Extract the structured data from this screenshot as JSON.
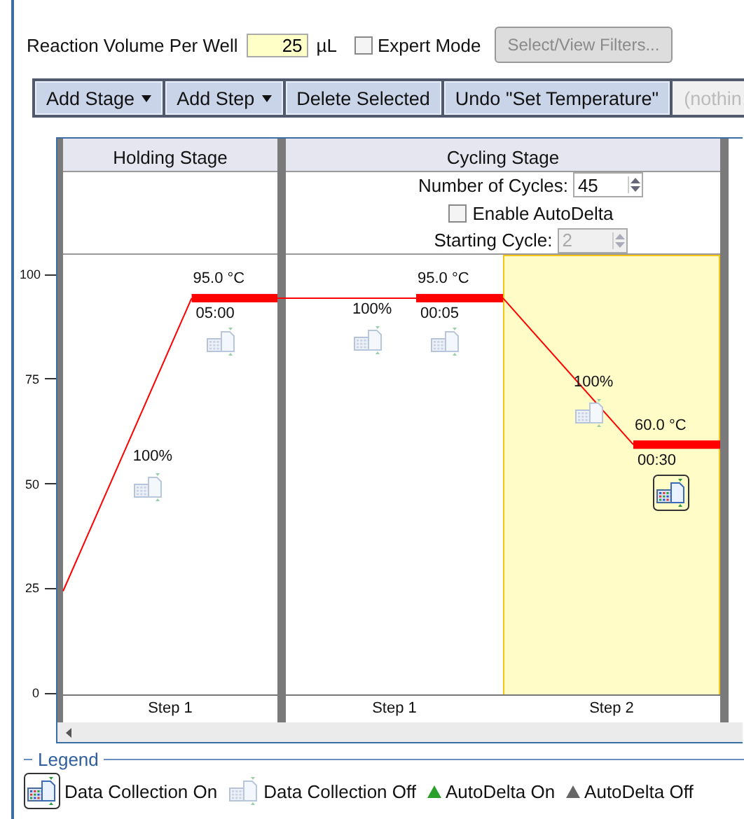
{
  "reaction_volume": {
    "label": "Reaction Volume Per Well",
    "value": "25",
    "unit": "µL"
  },
  "expert_mode": {
    "label": "Expert Mode",
    "checked": false
  },
  "filters_button": {
    "label": "Select/View Filters...",
    "disabled": true
  },
  "toolbar": [
    {
      "label": "Add Stage",
      "dropdown": true,
      "disabled": false
    },
    {
      "label": "Add Step",
      "dropdown": true,
      "disabled": false
    },
    {
      "label": "Delete Selected",
      "dropdown": false,
      "disabled": false
    },
    {
      "label": "Undo \"Set Temperature\"",
      "dropdown": false,
      "disabled": false
    },
    {
      "label": "(nothin",
      "dropdown": false,
      "disabled": true
    }
  ],
  "y_axis_ticks": [
    "100",
    "75",
    "50",
    "25",
    "0"
  ],
  "stages": [
    {
      "title": "Holding Stage",
      "steps": [
        {
          "label": "Step 1",
          "temperature": "95.0 °C",
          "time": "05:00",
          "ramp": "100%",
          "data_collection": false,
          "selected": false
        }
      ]
    },
    {
      "title": "Cycling Stage",
      "cycles": {
        "label": "Number of Cycles:",
        "value": "45"
      },
      "autodelta": {
        "label": "Enable AutoDelta",
        "checked": false
      },
      "starting_cycle": {
        "label": "Starting Cycle:",
        "value": "2",
        "disabled": true
      },
      "steps": [
        {
          "label": "Step 1",
          "temperature": "95.0 °C",
          "time": "00:05",
          "ramp": "100%",
          "data_collection": false,
          "selected": false
        },
        {
          "label": "Step 2",
          "temperature": "60.0 °C",
          "time": "00:30",
          "ramp": "100%",
          "data_collection": true,
          "selected": true
        }
      ]
    }
  ],
  "legend": {
    "title": "Legend",
    "items": [
      {
        "kind": "collection_on",
        "label": "Data Collection On"
      },
      {
        "kind": "collection_off",
        "label": "Data Collection Off"
      },
      {
        "kind": "autodelta_on",
        "label": "AutoDelta On"
      },
      {
        "kind": "autodelta_off",
        "label": "AutoDelta Off"
      }
    ]
  }
}
